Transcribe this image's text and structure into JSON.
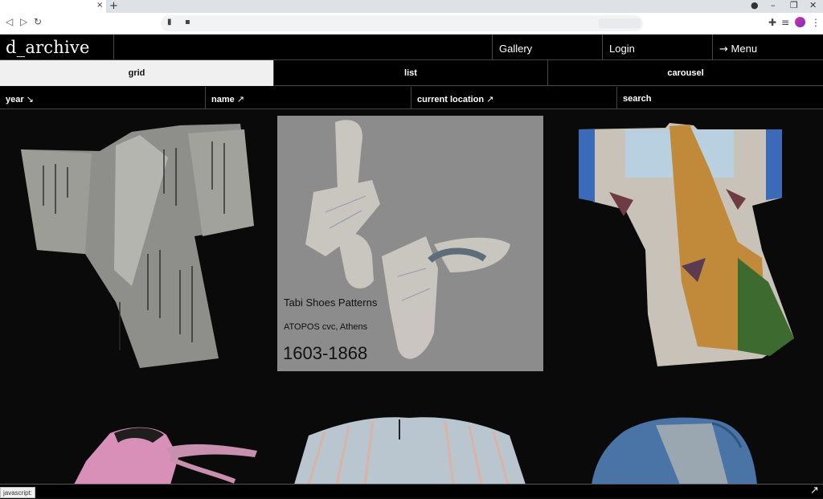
{
  "browser": {
    "tab_close": "×",
    "new_tab": "+",
    "minimize": "–",
    "restore": "❐",
    "close": "✕",
    "back": "◁",
    "forward": "▷",
    "reload": "↻",
    "bookmark_icon": "bookmark-icon",
    "lock_icon": "lock-icon",
    "extensions_icon": "puzzle-icon",
    "media_icon": "media-queue-icon",
    "menu_icon": "kebab-menu-icon",
    "status_url": "javascript:"
  },
  "header": {
    "logo": "d_archive",
    "gallery": "Gallery",
    "login": "Login",
    "menu_arrow": "→",
    "menu": "Menu"
  },
  "view_tabs": {
    "grid": "grid",
    "list": "list",
    "carousel": "carousel"
  },
  "filters": {
    "year": "year",
    "year_arrow": "↘",
    "name": "name",
    "name_arrow": "↗",
    "location": "current location",
    "location_arrow": "↗",
    "search": "search"
  },
  "grid": {
    "hover_card": {
      "title": "Tabi Shoes Patterns",
      "location": "ATOPOS cvc, Athens",
      "year": "1603-1868"
    }
  },
  "corner_arrow": "↗",
  "colors": {
    "background": "#0a0a0a",
    "active_tab": "#f0f0f0",
    "hover_card": "#8c8c8c"
  }
}
